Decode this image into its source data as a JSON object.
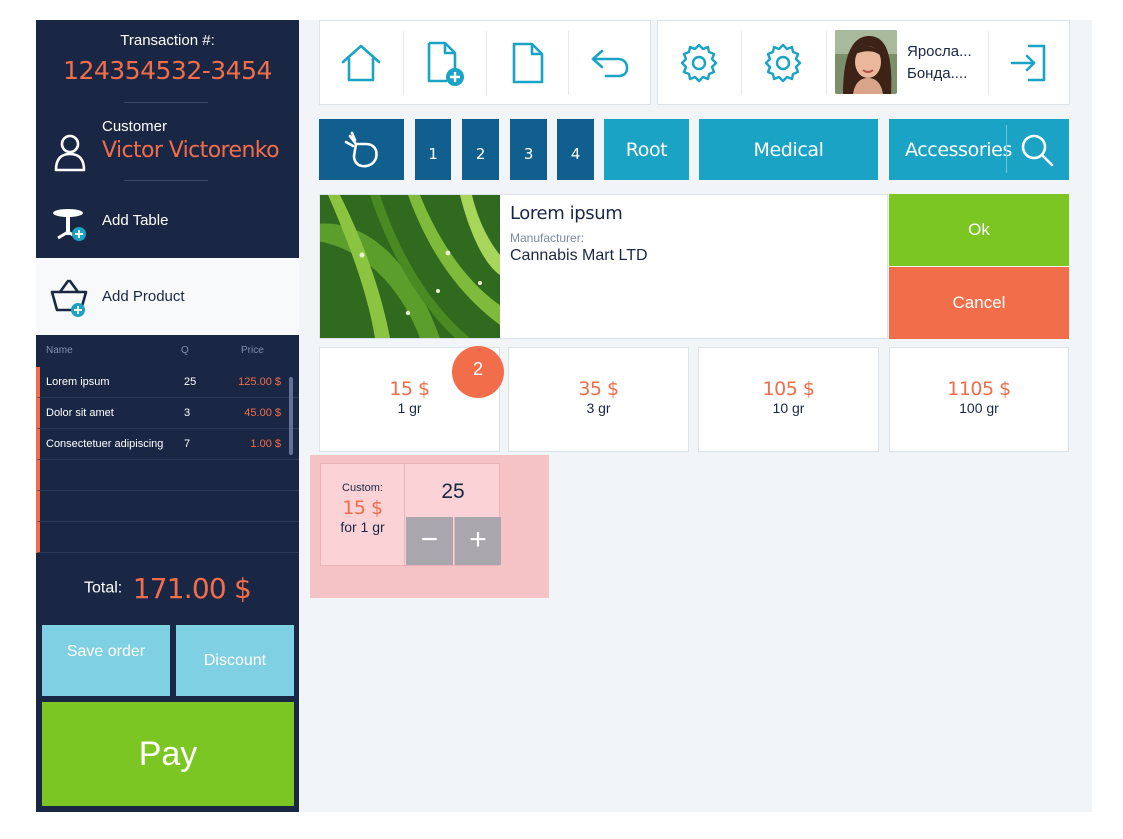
{
  "transaction": {
    "label": "Transaction #:",
    "number": "124354532-3454"
  },
  "customer": {
    "label": "Customer",
    "name": "Victor Victorenko"
  },
  "actions": {
    "add_table": "Add Table",
    "add_product": "Add Product"
  },
  "order": {
    "headers": {
      "name": "Name",
      "qty": "Q",
      "price": "Price"
    },
    "rows": [
      {
        "name": "Lorem ipsum",
        "qty": "25",
        "price": "125.00 $"
      },
      {
        "name": "Dolor sit amet",
        "qty": "3",
        "price": "45.00 $"
      },
      {
        "name": "Consectetuer adipiscing",
        "qty": "7",
        "price": "1.00 $"
      }
    ]
  },
  "total": {
    "label": "Total:",
    "value": "171.00 $"
  },
  "buttons": {
    "save_order": "Save order",
    "discount": "Discount",
    "pay": "Pay",
    "ok": "Ok",
    "cancel": "Cancel"
  },
  "toolbar": {
    "icons": [
      "home-icon",
      "new-document-icon",
      "document-icon",
      "undo-icon",
      "gear-icon",
      "gear-icon",
      "logout-icon"
    ],
    "user": {
      "line1": "Яросла...",
      "line2": "Бонда...."
    }
  },
  "categories": {
    "numbers": [
      "1",
      "2",
      "3",
      "4"
    ],
    "root": "Root",
    "medical": "Medical",
    "accessories": "Accessories"
  },
  "product": {
    "title": "Lorem ipsum",
    "manufacturer_label": "Manufacturer:",
    "manufacturer": "Cannabis Mart LTD"
  },
  "prices": [
    {
      "price": "15 $",
      "weight": "1 gr"
    },
    {
      "price": "35 $",
      "weight": "3 gr"
    },
    {
      "price": "105 $",
      "weight": "10 gr"
    },
    {
      "price": "1105 $",
      "weight": "100 gr"
    }
  ],
  "selected_badge": "2",
  "custom": {
    "label": "Custom:",
    "price": "15 $",
    "unit": "for 1 gr",
    "quantity": "25",
    "minus": "−",
    "plus": "+"
  },
  "colors": {
    "navy": "#1a2744",
    "accent": "#f26d4a",
    "teal": "#1aa3c4",
    "dark_blue": "#115f8f",
    "green": "#7cc623",
    "light_blue": "#7fd0e2"
  }
}
